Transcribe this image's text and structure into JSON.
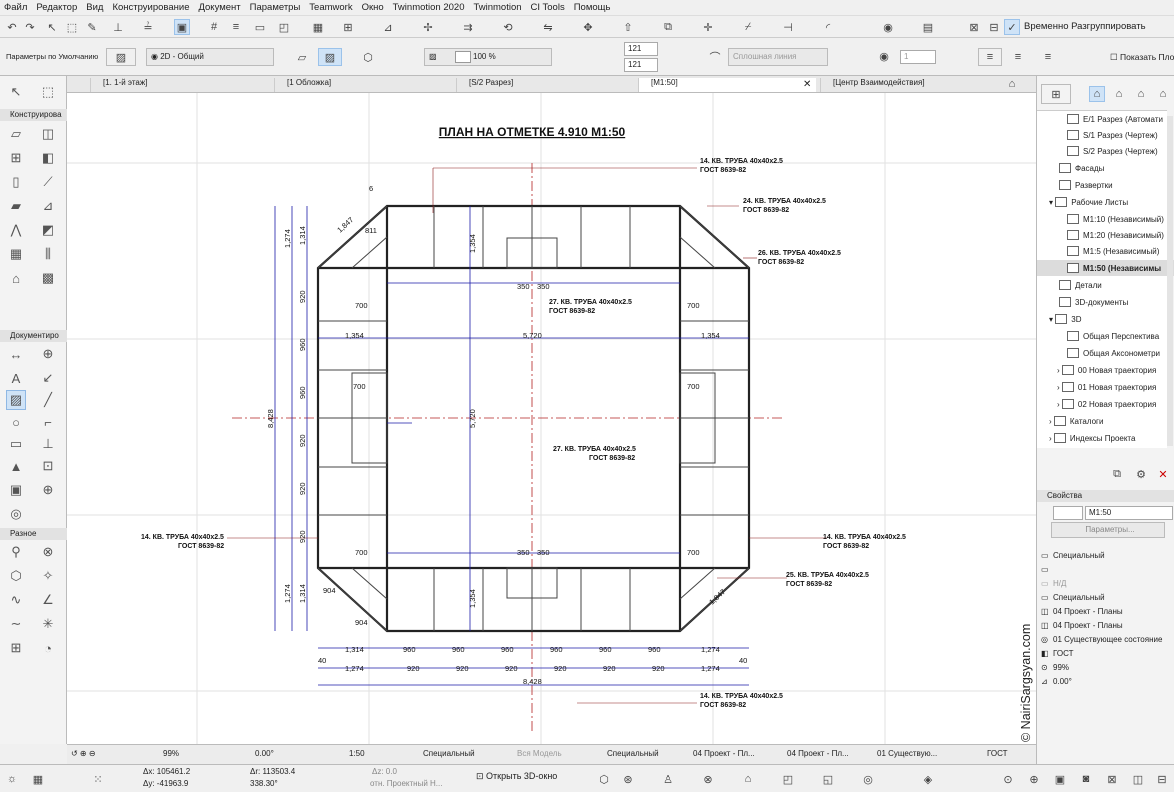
{
  "menu": [
    "Файл",
    "Редактор",
    "Вид",
    "Конструирование",
    "Документ",
    "Параметры",
    "Teamwork",
    "Окно",
    "Twinmotion 2020",
    "Twinmotion",
    "CI Tools",
    "Помощь"
  ],
  "toolbar": {
    "group_label": "Временно Разгруппировать"
  },
  "info_box": {
    "defaults_label": "Параметры по Умолчанию",
    "view_select": "2D - Общий",
    "percent": "100 %",
    "val_a": "121",
    "val_b": "121",
    "line_type": "Сплошная линия",
    "val_c": "1",
    "show_label": "Показать Пло"
  },
  "tabs": [
    "[1. 1-й этаж]",
    "[1 Обложка]",
    "[S/2 Разрез]",
    "[M1:50]",
    "[Центр Взаимодействия]"
  ],
  "toolbox": {
    "construction": "Конструирова",
    "document": "Документиро",
    "misc": "Разное"
  },
  "drawing": {
    "title": "ПЛАН НА ОТМЕТКЕ  4.910  М1:50",
    "annotations": [
      {
        "l1": "14. КВ. ТРУБА 40х40х2.5",
        "l2": "ГОСТ 8639-82"
      },
      {
        "l1": "24. КВ. ТРУБА 40х40х2.5",
        "l2": "ГОСТ 8639-82"
      },
      {
        "l1": "26. КВ. ТРУБА 40х40х2.5",
        "l2": "ГОСТ 8639-82"
      },
      {
        "l1": "27. КВ. ТРУБА 40х40х2.5",
        "l2": "ГОСТ 8639-82"
      },
      {
        "l1": "27. КВ. ТРУБА 40х40х2.5",
        "l2": "ГОСТ 8639-82"
      },
      {
        "l1": "14. КВ. ТРУБА 40х40х2.5",
        "l2": "ГОСТ 8639-82"
      },
      {
        "l1": "14. КВ. ТРУБА 40х40х2.5",
        "l2": "ГОСТ 8639-82"
      },
      {
        "l1": "25. КВ. ТРУБА 40х40х2.5",
        "l2": "ГОСТ 8639-82"
      },
      {
        "l1": "14. КВ. ТРУБА 40х40х2.5",
        "l2": "ГОСТ 8639-82"
      }
    ],
    "dims": {
      "d1274": "1,274",
      "d1314": "1,314",
      "d1354": "1,354",
      "d700": "700",
      "d350": "350",
      "d5720": "5,720",
      "d920": "920",
      "d960": "960",
      "d40": "40",
      "d8428": "8,428",
      "d1847": "1,847",
      "d811": "811",
      "d904": "904",
      "d6": "6"
    },
    "colors": {
      "frame": "#222222",
      "dim": "#1a1aa8",
      "axis": "#b22222",
      "note": "#8b1a1a"
    }
  },
  "navigator": {
    "items": [
      "E/1 Разрез (Автомати",
      "S/1 Разрез (Чертеж)",
      "S/2 Разрез (Чертеж)",
      "Фасады",
      "Развертки",
      "Рабочие Листы",
      "M1:10 (Независимый)",
      "M1:20 (Независимый)",
      "M1:5 (Независимый)",
      "M1:50 (Независимы",
      "Детали",
      "3D-документы",
      "3D",
      "Общая Перспектива",
      "Общая Аксонометри",
      "00 Новая траектория",
      "01 Новая траектория",
      "02 Новая траектория",
      "Каталоги",
      "Индексы Проекта"
    ]
  },
  "properties": {
    "title": "Свойства",
    "name": "M1:50",
    "params_button": "Параметры...",
    "rows": [
      "Специальный",
      "Н/Д",
      "Специальный",
      "04 Проект - Планы",
      "04 Проект - Планы",
      "01 Существующее состояние",
      "ГОСТ",
      "99%",
      "0.00°"
    ]
  },
  "status": {
    "zoom": "99%",
    "angle": "0.00°",
    "scale": "1:50",
    "layer": "Специальный",
    "model": "Вся Модель",
    "pen": "Специальный",
    "view1": "04 Проект - Пл...",
    "view2": "04 Проект - Пл...",
    "renov": "01 Существую...",
    "std": "ГОСТ"
  },
  "bottom": {
    "dx": "Δx: 105461.2",
    "dy": "Δy: -41963.9",
    "dr": "Δr: 113503.4",
    "da": "338.30°",
    "dz": "Δz: 0.0",
    "dz_ref": "отн. Проектный Н...",
    "open3d": "Открыть 3D-окно"
  },
  "watermark": "© NairiSargsyan.com"
}
